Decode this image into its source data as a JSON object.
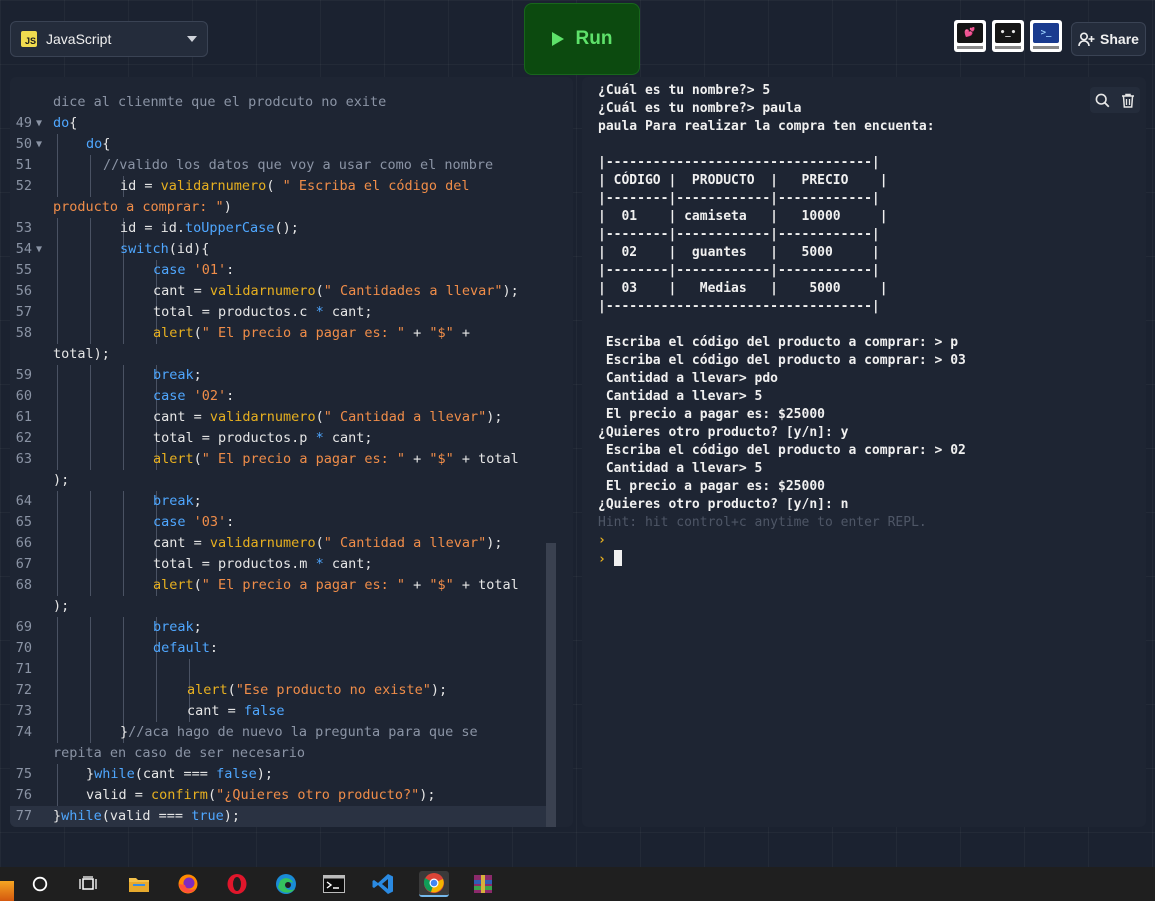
{
  "header": {
    "language": "JavaScript",
    "language_badge": "JS",
    "run_label": "Run",
    "share_label": "Share",
    "avatars": [
      "💕",
      "•_•",
      ">_"
    ]
  },
  "editor": {
    "lines": [
      {
        "n": "",
        "fold": false,
        "indent": 0,
        "html": "<span class=\"c\">dice al clienmte que el prodcuto no exite</span>"
      },
      {
        "n": "49",
        "fold": true,
        "indent": 0,
        "html": "<span class=\"k\">do</span><span class=\"p\">{</span>"
      },
      {
        "n": "50",
        "fold": true,
        "indent": 1,
        "html": "<span class=\"k\">do</span><span class=\"p\">{</span>"
      },
      {
        "n": "51",
        "fold": false,
        "indent": 2,
        "html": "<span class=\"c\">//valido los datos que voy a usar como el nombre</span>"
      },
      {
        "n": "52",
        "fold": false,
        "indent": 3,
        "html": "<span class=\"p\">id = </span><span class=\"f\">validarnumero</span><span class=\"p\">( </span><span class=\"s\">\" Escriba el código del</span>"
      },
      {
        "n": "",
        "fold": false,
        "indent": 0,
        "html": "<span class=\"s\">producto a comprar: \"</span><span class=\"p\">)</span>"
      },
      {
        "n": "53",
        "fold": false,
        "indent": 3,
        "html": "<span class=\"p\">id = id.</span><span class=\"k\">toUpperCase</span><span class=\"p\">();</span>"
      },
      {
        "n": "54",
        "fold": true,
        "indent": 3,
        "html": "<span class=\"k\">switch</span><span class=\"p\">(id){</span>"
      },
      {
        "n": "55",
        "fold": false,
        "indent": 4,
        "html": "<span class=\"k\">case</span> <span class=\"s\">'01'</span><span class=\"p\">:</span>"
      },
      {
        "n": "56",
        "fold": false,
        "indent": 4,
        "html": "<span class=\"p\">cant = </span><span class=\"f\">validarnumero</span><span class=\"p\">(</span><span class=\"s\">\" Cantidades a llevar\"</span><span class=\"p\">);</span>"
      },
      {
        "n": "57",
        "fold": false,
        "indent": 4,
        "html": "<span class=\"p\">total = productos.c </span><span class=\"k\">*</span><span class=\"p\"> cant;</span>"
      },
      {
        "n": "58",
        "fold": false,
        "indent": 4,
        "html": "<span class=\"f\">alert</span><span class=\"p\">(</span><span class=\"s\">\" El precio a pagar es: \"</span><span class=\"p\"> + </span><span class=\"s\">\"$\"</span><span class=\"p\"> +</span>"
      },
      {
        "n": "",
        "fold": false,
        "indent": 0,
        "html": "<span class=\"p\">total);</span>"
      },
      {
        "n": "59",
        "fold": false,
        "indent": 4,
        "html": "<span class=\"k\">break</span><span class=\"p\">;</span>"
      },
      {
        "n": "60",
        "fold": false,
        "indent": 4,
        "html": "<span class=\"k\">case</span> <span class=\"s\">'02'</span><span class=\"p\">:</span>"
      },
      {
        "n": "61",
        "fold": false,
        "indent": 4,
        "html": "<span class=\"p\">cant = </span><span class=\"f\">validarnumero</span><span class=\"p\">(</span><span class=\"s\">\" Cantidad a llevar\"</span><span class=\"p\">);</span>"
      },
      {
        "n": "62",
        "fold": false,
        "indent": 4,
        "html": "<span class=\"p\">total = productos.p </span><span class=\"k\">*</span><span class=\"p\"> cant;</span>"
      },
      {
        "n": "63",
        "fold": false,
        "indent": 4,
        "html": "<span class=\"f\">alert</span><span class=\"p\">(</span><span class=\"s\">\" El precio a pagar es: \"</span><span class=\"p\"> + </span><span class=\"s\">\"$\"</span><span class=\"p\"> + total</span>"
      },
      {
        "n": "",
        "fold": false,
        "indent": 0,
        "html": "<span class=\"p\">);</span>"
      },
      {
        "n": "64",
        "fold": false,
        "indent": 4,
        "html": "<span class=\"k\">break</span><span class=\"p\">;</span>"
      },
      {
        "n": "65",
        "fold": false,
        "indent": 4,
        "html": "<span class=\"k\">case</span> <span class=\"s\">'03'</span><span class=\"p\">:</span>"
      },
      {
        "n": "66",
        "fold": false,
        "indent": 4,
        "html": "<span class=\"p\">cant = </span><span class=\"f\">validarnumero</span><span class=\"p\">(</span><span class=\"s\">\" Cantidad a llevar\"</span><span class=\"p\">);</span>"
      },
      {
        "n": "67",
        "fold": false,
        "indent": 4,
        "html": "<span class=\"p\">total = productos.m </span><span class=\"k\">*</span><span class=\"p\"> cant;</span>"
      },
      {
        "n": "68",
        "fold": false,
        "indent": 4,
        "html": "<span class=\"f\">alert</span><span class=\"p\">(</span><span class=\"s\">\" El precio a pagar es: \"</span><span class=\"p\"> + </span><span class=\"s\">\"$\"</span><span class=\"p\"> + total</span>"
      },
      {
        "n": "",
        "fold": false,
        "indent": 0,
        "html": "<span class=\"p\">);</span>"
      },
      {
        "n": "69",
        "fold": false,
        "indent": 4,
        "html": "<span class=\"k\">break</span><span class=\"p\">;</span>"
      },
      {
        "n": "70",
        "fold": false,
        "indent": 4,
        "html": "<span class=\"k\">default</span><span class=\"p\">:</span>"
      },
      {
        "n": "71",
        "fold": false,
        "indent": 5,
        "html": ""
      },
      {
        "n": "72",
        "fold": false,
        "indent": 5,
        "html": "<span class=\"f\">alert</span><span class=\"p\">(</span><span class=\"s\">\"Ese producto no existe\"</span><span class=\"p\">);</span>"
      },
      {
        "n": "73",
        "fold": false,
        "indent": 5,
        "html": "<span class=\"p\">cant = </span><span class=\"k\">false</span>"
      },
      {
        "n": "74",
        "fold": false,
        "indent": 3,
        "html": "<span class=\"p\">}</span><span class=\"c\">//aca hago de nuevo la pregunta para que se</span>"
      },
      {
        "n": "",
        "fold": false,
        "indent": 0,
        "html": "<span class=\"c\">repita en caso de ser necesario</span>"
      },
      {
        "n": "75",
        "fold": false,
        "indent": 1,
        "html": "<span class=\"p\">}</span><span class=\"k\">while</span><span class=\"p\">(cant === </span><span class=\"k\">false</span><span class=\"p\">);</span>"
      },
      {
        "n": "76",
        "fold": false,
        "indent": 1,
        "html": "<span class=\"p\">valid = </span><span class=\"f\">confirm</span><span class=\"p\">(</span><span class=\"s\">\"¿Quieres otro producto?\"</span><span class=\"p\">);</span>"
      },
      {
        "n": "77",
        "fold": false,
        "indent": 0,
        "active": true,
        "html": "<span class=\"p\">}</span><span class=\"k\">while</span><span class=\"p\">(valid === </span><span class=\"k\">true</span><span class=\"p\">);</span>"
      }
    ]
  },
  "console": {
    "lines": [
      "¿Cuál es tu nombre?> 5",
      "¿Cuál es tu nombre?> paula",
      "paula Para realizar la compra ten encuenta:",
      "",
      "|----------------------------------|",
      "| CÓDIGO |  PRODUCTO  |   PRECIO    |",
      "|--------|------------|------------|",
      "|  01    | camiseta   |   10000     |",
      "|--------|------------|------------|",
      "|  02    |  guantes   |   5000     |",
      "|--------|------------|------------|",
      "|  03    |   Medias   |    5000     |",
      "|----------------------------------|",
      "",
      " Escriba el código del producto a comprar: > p",
      " Escriba el código del producto a comprar: > 03",
      " Cantidad a llevar> pdo",
      " Cantidad a llevar> 5",
      " El precio a pagar es: $25000",
      "¿Quieres otro producto? [y/n]: y",
      " Escriba el código del producto a comprar: > 02",
      " Cantidad a llevar> 5",
      " El precio a pagar es: $25000",
      "¿Quieres otro producto? [y/n]: n"
    ],
    "hint": "Hint: hit control+c anytime to enter REPL.",
    "prompt_char": "›"
  },
  "taskbar": {
    "icons": [
      "cortana-icon",
      "task-view-icon",
      "file-explorer-icon",
      "firefox-icon",
      "opera-icon",
      "edge-icon",
      "terminal-icon",
      "vscode-icon",
      "chrome-icon",
      "winrar-icon"
    ]
  },
  "colors": {
    "background": "#1b2230",
    "panel": "#1e2533",
    "keyword": "#4fa7ff",
    "string": "#f08d49",
    "function": "#e7b020",
    "comment": "#8b94a5",
    "run_green": "#5ee26a"
  }
}
